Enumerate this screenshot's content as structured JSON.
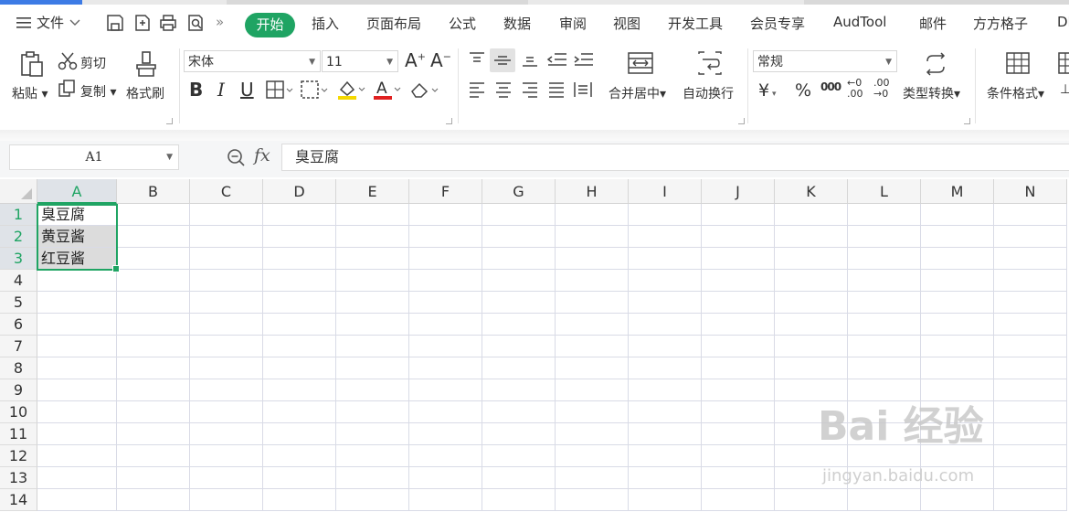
{
  "menu": {
    "file_label": "文件",
    "tabs": [
      "开始",
      "插入",
      "页面布局",
      "公式",
      "数据",
      "审阅",
      "视图",
      "开发工具",
      "会员专享",
      "AudTool",
      "邮件",
      "方方格子",
      "DI"
    ],
    "active_tab": "开始"
  },
  "ribbon": {
    "paste": "粘贴",
    "cut": "剪切",
    "copy": "复制",
    "format_painter": "格式刷",
    "font_name": "宋体",
    "font_size": "11",
    "merge_center": "合并居中",
    "wrap_text": "自动换行",
    "number_format": "常规",
    "type_convert": "类型转换",
    "conditional_format": "条件格式",
    "percent": "%",
    "thousands": "000",
    "inc_decimal": "←0 .00",
    "dec_decimal": ".00 →0"
  },
  "formula_bar": {
    "name_box": "A1",
    "fx": "fx",
    "content": "臭豆腐"
  },
  "grid": {
    "columns": [
      "A",
      "B",
      "C",
      "D",
      "E",
      "F",
      "G",
      "H",
      "I",
      "J",
      "K",
      "L",
      "M",
      "N"
    ],
    "rows": [
      "1",
      "2",
      "3",
      "4",
      "5",
      "6",
      "7",
      "8",
      "9",
      "10",
      "11",
      "12",
      "13",
      "14"
    ],
    "cells": {
      "A1": "臭豆腐",
      "A2": "黄豆酱",
      "A3": "红豆酱"
    }
  },
  "watermark": {
    "main": "Bai 经验",
    "sub": "jingyan.baidu.com"
  },
  "colors": {
    "accent": "#1fa463",
    "blue_strip": "#3d7be5"
  }
}
